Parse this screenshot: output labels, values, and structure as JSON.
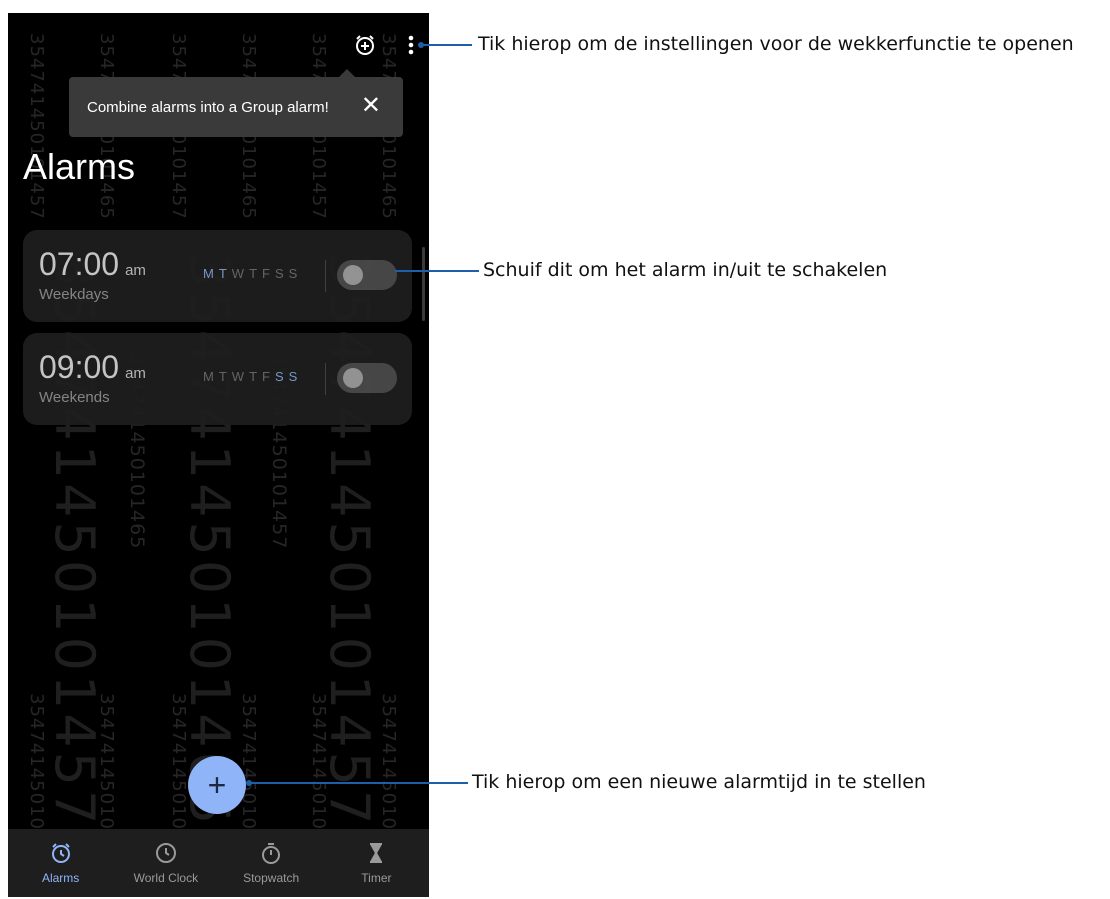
{
  "watermark": {
    "small": "354741450101457",
    "alt": "354741450101465"
  },
  "tooltip": {
    "text": "Combine alarms into a Group alarm!",
    "close_icon": "close-icon"
  },
  "page": {
    "title": "Alarms"
  },
  "alarms": [
    {
      "time": "07:00",
      "ampm": "am",
      "label": "Weekdays",
      "days": [
        "M",
        "T",
        "W",
        "T",
        "F",
        "S",
        "S"
      ],
      "enabled": false
    },
    {
      "time": "09:00",
      "ampm": "am",
      "label": "Weekends",
      "days": [
        "M",
        "T",
        "W",
        "T",
        "F",
        "S",
        "S"
      ],
      "enabled": false
    }
  ],
  "nav": [
    {
      "label": "Alarms",
      "icon": "alarm-icon"
    },
    {
      "label": "World Clock",
      "icon": "clock-icon"
    },
    {
      "label": "Stopwatch",
      "icon": "stopwatch-icon"
    },
    {
      "label": "Timer",
      "icon": "hourglass-icon"
    }
  ],
  "fab": {
    "label": "+"
  },
  "callouts": {
    "settings": "Tik hierop om de instellingen voor de wekkerfunctie te openen",
    "toggle": "Schuif dit om het alarm in/uit te schakelen",
    "add": "Tik hierop om een nieuwe alarmtijd in te stellen"
  },
  "colors": {
    "accent": "#8fb4f7",
    "leader": "#1f5ea8"
  }
}
